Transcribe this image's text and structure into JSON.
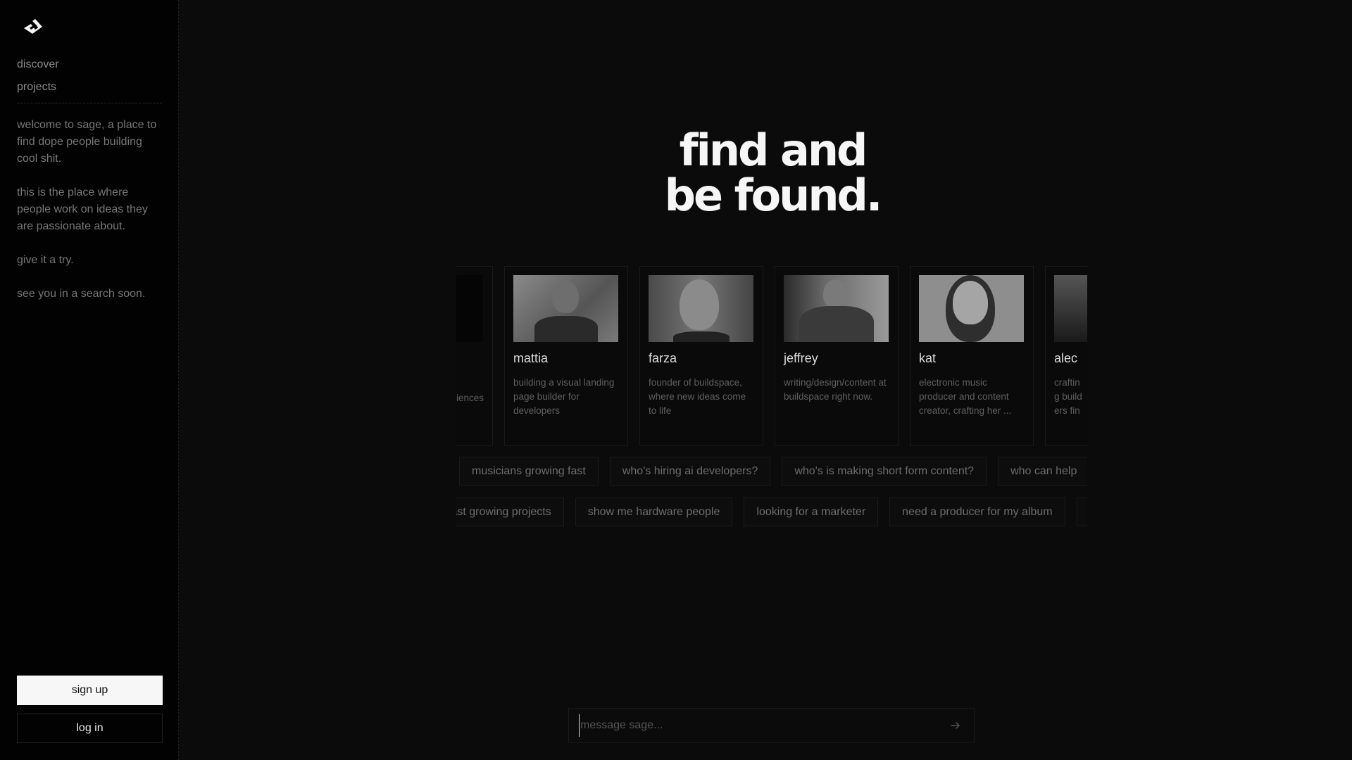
{
  "sidebar": {
    "logo": "sage-logo",
    "nav": [
      {
        "label": "discover"
      },
      {
        "label": "projects"
      }
    ],
    "intro": [
      "welcome to sage, a place to find dope people building cool shit.",
      "this is the place where people work on ideas they are passionate about.",
      "give it a try.",
      "see you in a search soon."
    ],
    "signup_label": "sign up",
    "login_label": "log in"
  },
  "hero": {
    "line1": "find and",
    "line2": "be found."
  },
  "cards": [
    {
      "name": "",
      "desc": "experiences"
    },
    {
      "name": "mattia",
      "desc": "building a visual landing page builder for developers"
    },
    {
      "name": "farza",
      "desc": "founder of buildspace, where new ideas come to life"
    },
    {
      "name": "jeffrey",
      "desc": "writing/design/content at buildspace right now."
    },
    {
      "name": "kat",
      "desc": "electronic music producer and content creator, crafting her ..."
    },
    {
      "name": "alec",
      "desc": "crafting builders fine-tuning"
    }
  ],
  "chips_row1": [
    "musicians growing fast",
    "who's hiring ai developers?",
    "who's is making short form content?",
    "who can help"
  ],
  "chips_row2": [
    "fast growing projects",
    "show me hardware people",
    "looking for a marketer",
    "need a producer for my album",
    ""
  ],
  "composer": {
    "placeholder": "message sage...",
    "value": "",
    "send_icon": "arrow-right-icon"
  },
  "colors": {
    "background": "#0b0b0c",
    "sidebar": "#020202",
    "primary_button": "#f7f7f7",
    "text_muted": "#777777"
  }
}
